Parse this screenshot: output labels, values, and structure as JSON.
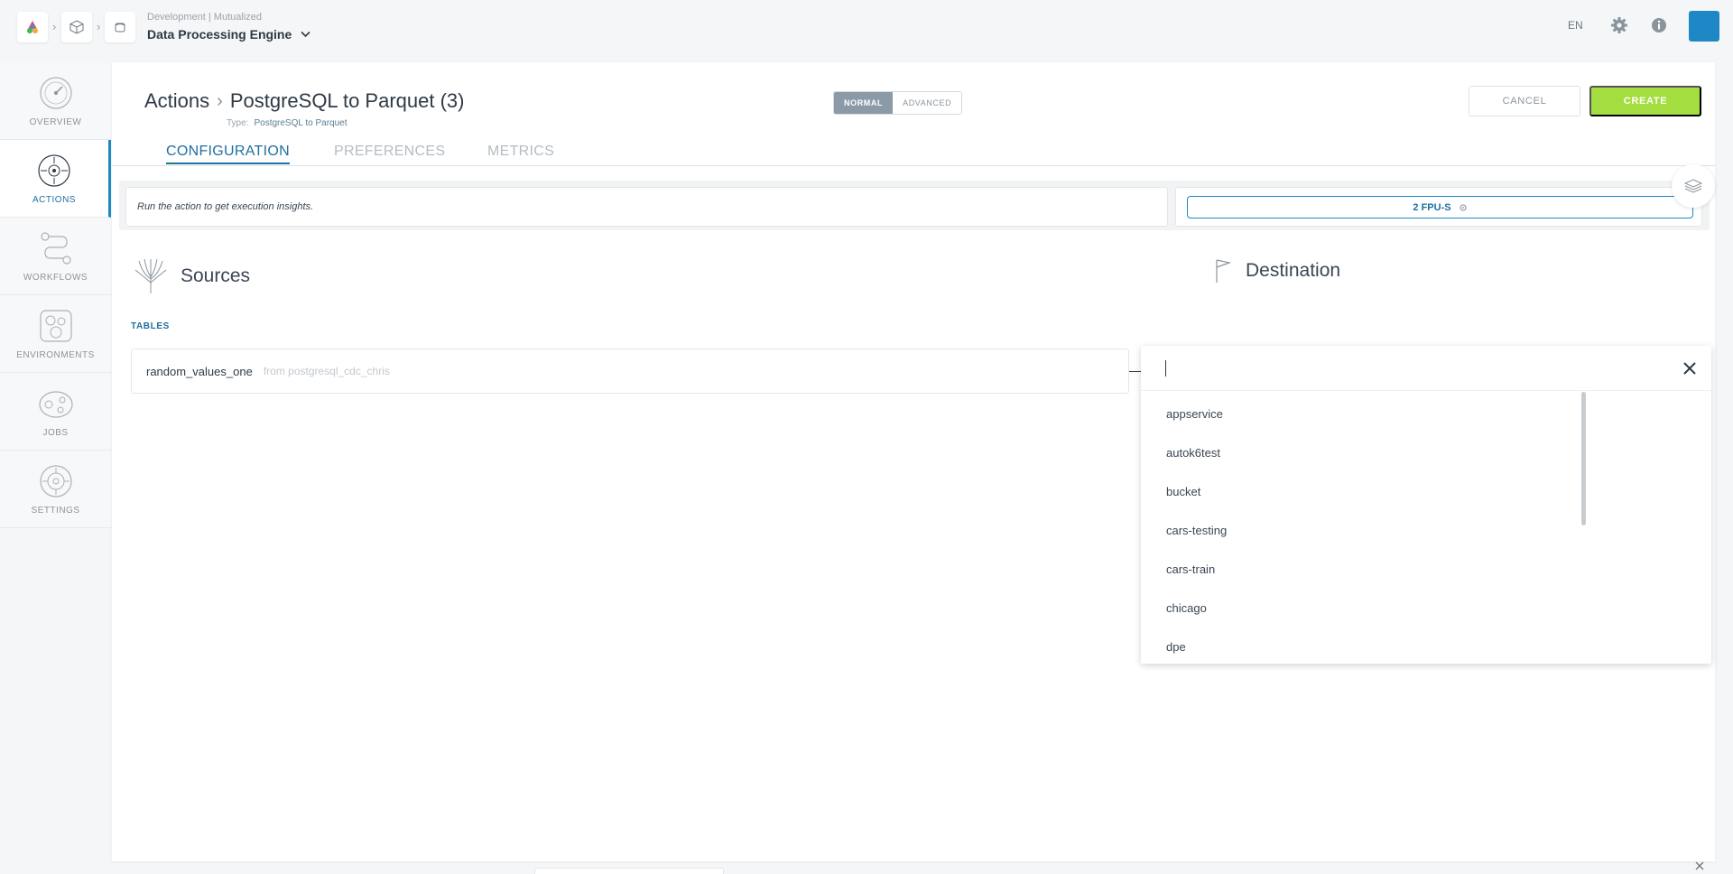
{
  "topbar": {
    "breadcrumb_icons": [
      "org-logo-icon",
      "cube-icon",
      "engine-icon"
    ],
    "environment": "Development | Mutualized",
    "project": "Data Processing Engine",
    "language": "EN"
  },
  "sidenav": {
    "items": [
      {
        "label": "OVERVIEW",
        "icon": "gauge-icon",
        "active": false
      },
      {
        "label": "ACTIONS",
        "icon": "target-icon",
        "active": true
      },
      {
        "label": "WORKFLOWS",
        "icon": "workflow-icon",
        "active": false
      },
      {
        "label": "ENVIRONMENTS",
        "icon": "environments-icon",
        "active": false
      },
      {
        "label": "JOBS",
        "icon": "jobs-icon",
        "active": false
      },
      {
        "label": "SETTINGS",
        "icon": "settings-icon",
        "active": false
      }
    ]
  },
  "header": {
    "section": "Actions",
    "title": "PostgreSQL to Parquet (3)",
    "type_label": "Type:",
    "type_value": "PostgreSQL to Parquet",
    "mode_normal": "NORMAL",
    "mode_advanced": "ADVANCED",
    "cancel_label": "CANCEL",
    "create_label": "CREATE"
  },
  "tabs": [
    {
      "label": "CONFIGURATION",
      "active": true
    },
    {
      "label": "PREFERENCES",
      "active": false
    },
    {
      "label": "METRICS",
      "active": false
    }
  ],
  "insights": {
    "message": "Run the action to get execution insights.",
    "fpu": "2 FPU-S"
  },
  "sources": {
    "heading": "Sources",
    "tables_label": "TABLES",
    "table_name": "random_values_one",
    "table_from": "from postgresql_cdc_chris"
  },
  "destination": {
    "heading": "Destination",
    "search_value": "",
    "options": [
      "appservice",
      "autok6test",
      "bucket",
      "cars-testing",
      "cars-train",
      "chicago",
      "dpe"
    ]
  },
  "colors": {
    "accent": "#1e88c7",
    "create": "#a4dd3f",
    "mode_active": "#8b9aa6"
  }
}
